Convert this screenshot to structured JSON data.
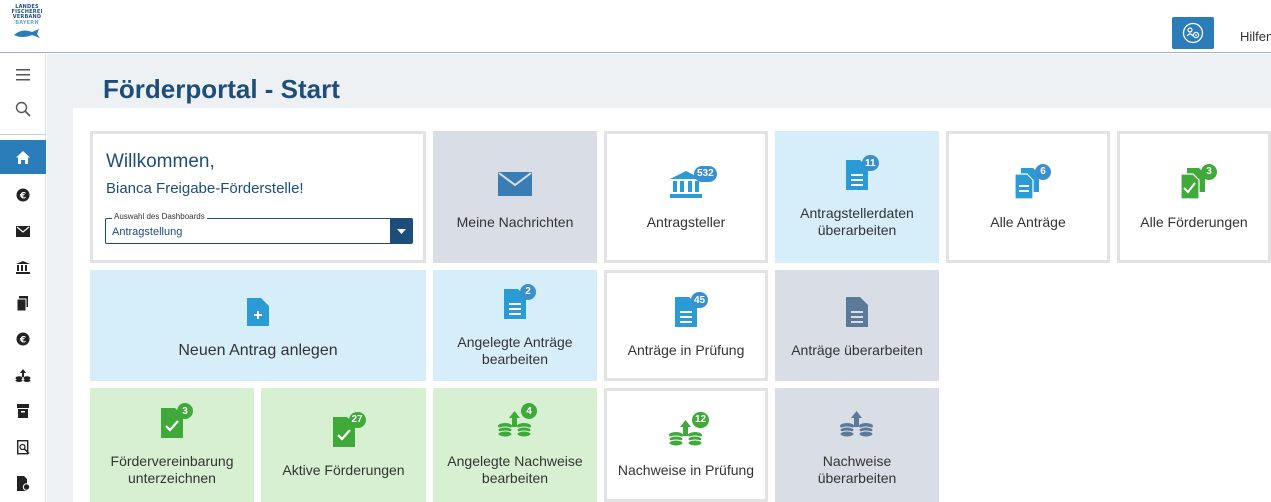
{
  "header": {
    "logo_lines": [
      "LANDES",
      "FISCHEREI",
      "VERBAND",
      "BAYERN"
    ],
    "help_label": "Hilfen",
    "help_icon": "people-gear-icon"
  },
  "sidebar": {
    "items": [
      {
        "name": "menu",
        "icon": "hamburger-icon"
      },
      {
        "name": "search",
        "icon": "search-icon"
      },
      {
        "name": "home",
        "icon": "home-icon"
      },
      {
        "name": "euro",
        "icon": "euro-icon"
      },
      {
        "name": "messages",
        "icon": "envelope-icon"
      },
      {
        "name": "institution",
        "icon": "bank-icon"
      },
      {
        "name": "documents",
        "icon": "documents-icon"
      },
      {
        "name": "euro-2",
        "icon": "euro-icon"
      },
      {
        "name": "funding",
        "icon": "coins-arrow-icon"
      },
      {
        "name": "archive",
        "icon": "archive-icon"
      },
      {
        "name": "review",
        "icon": "document-search-icon"
      },
      {
        "name": "approval",
        "icon": "document-check-icon"
      }
    ]
  },
  "page": {
    "title": "Förderportal - Start"
  },
  "welcome": {
    "line1": "Willkommen,",
    "line2": "Bianca Freigabe-Förderstelle!",
    "dashboard_legend": "Auswahl des Dashboards",
    "dashboard_value": "Antragstellung"
  },
  "tiles": {
    "meine_nachrichten": {
      "label": "Meine Nachrichten"
    },
    "antragsteller": {
      "label": "Antragsteller",
      "badge": "532"
    },
    "antragstellerdaten": {
      "label": "Antragstellerdaten überarbeiten",
      "badge": "11"
    },
    "alle_antraege": {
      "label": "Alle Anträge",
      "badge": "6"
    },
    "alle_foerderungen": {
      "label": "Alle Förderungen",
      "badge": "3"
    },
    "neuen_antrag": {
      "label": "Neuen Antrag anlegen"
    },
    "angelegte_antraege": {
      "label": "Angelegte Anträge bearbeiten",
      "badge": "2"
    },
    "antraege_pruefung": {
      "label": "Anträge in Prüfung",
      "badge": "45"
    },
    "antraege_ueberarbeiten": {
      "label": "Anträge überarbeiten"
    },
    "foerdervereinbarung": {
      "label": "Fördervereinbarung unterzeichnen",
      "badge": "3"
    },
    "aktive_foerderungen": {
      "label": "Aktive Förderungen",
      "badge": "27"
    },
    "angelegte_nachweise": {
      "label": "Angelegte Nachweise bearbeiten",
      "badge": "4"
    },
    "nachweise_pruefung": {
      "label": "Nachweise in Prüfung",
      "badge": "12"
    },
    "nachweise_ueberarbeiten": {
      "label": "Nachweise überarbeiten"
    }
  },
  "colors": {
    "primary": "#2a7db8",
    "dark_blue": "#1d4e7a",
    "tile_grey": "#d9dee6",
    "tile_blue": "#d6eef9",
    "tile_green": "#d8f0d2",
    "badge_blue": "#3a90cf",
    "badge_green": "#3fa93a"
  }
}
